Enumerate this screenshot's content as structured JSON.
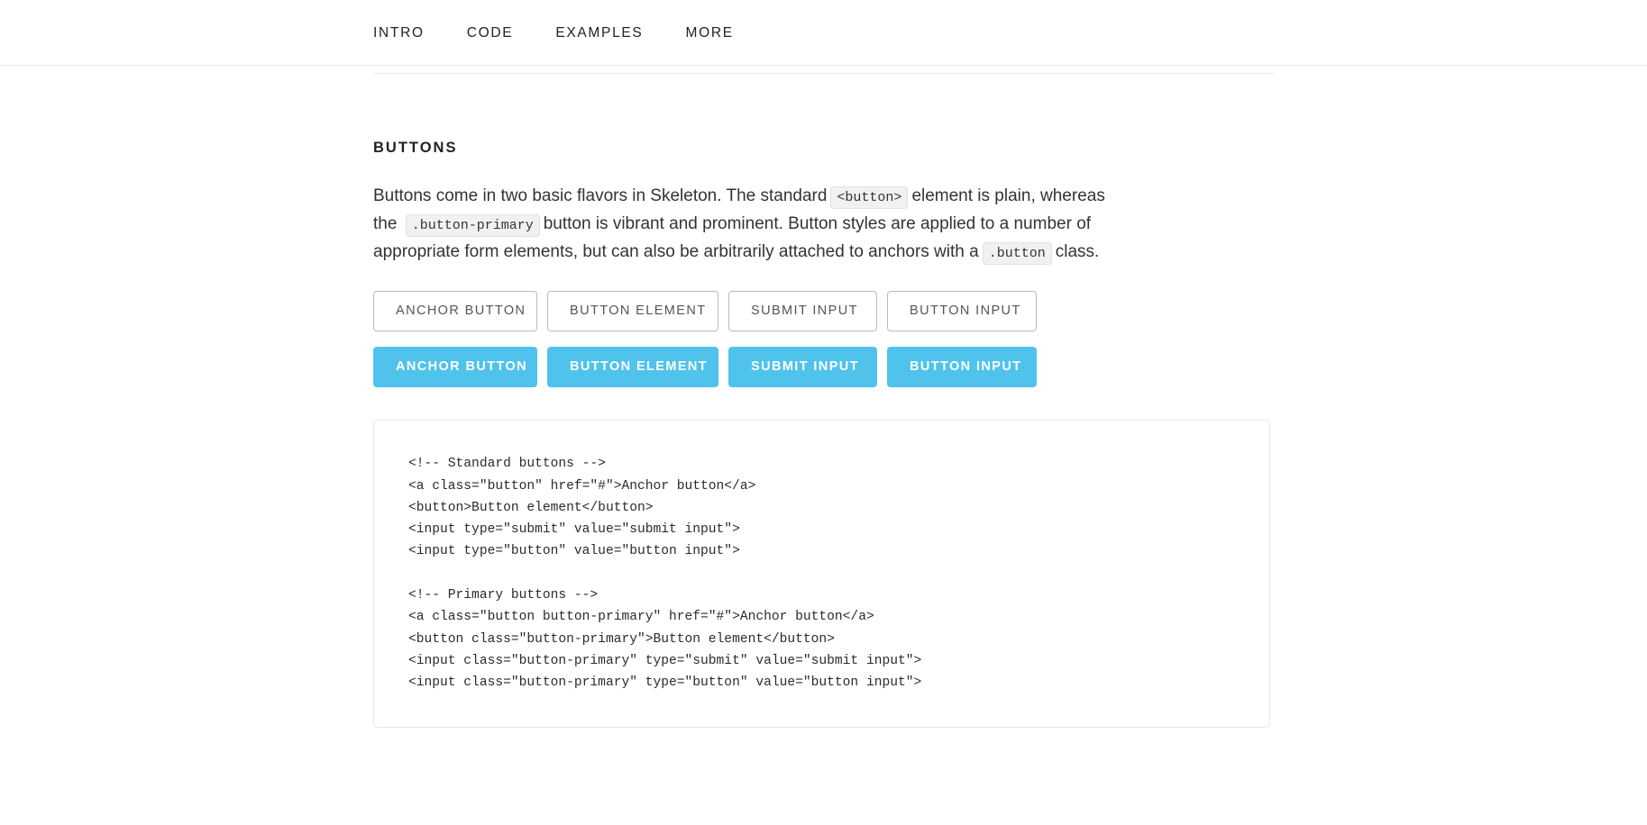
{
  "nav": {
    "items": [
      {
        "label": "INTRO"
      },
      {
        "label": "CODE"
      },
      {
        "label": "EXAMPLES"
      },
      {
        "label": "MORE"
      }
    ]
  },
  "section": {
    "title": "BUTTONS",
    "paragraph": {
      "part1": "Buttons come in two basic flavors in Skeleton. The standard",
      "code1": "<button>",
      "part2": "element is plain, whereas the",
      "code2": ".button-primary",
      "part3": "button is vibrant and prominent. Button styles are applied to a number of appropriate form elements, but can also be arbitrarily attached to anchors with a",
      "code3": ".button",
      "part4": "class."
    }
  },
  "buttons": {
    "standard": [
      {
        "label": "ANCHOR BUTTON"
      },
      {
        "label": "BUTTON ELEMENT"
      },
      {
        "label": "SUBMIT INPUT"
      },
      {
        "label": "BUTTON INPUT"
      }
    ],
    "primary": [
      {
        "label": "ANCHOR BUTTON"
      },
      {
        "label": "BUTTON ELEMENT"
      },
      {
        "label": "SUBMIT INPUT"
      },
      {
        "label": "BUTTON INPUT"
      }
    ]
  },
  "code_sample": "<!-- Standard buttons -->\n<a class=\"button\" href=\"#\">Anchor button</a>\n<button>Button element</button>\n<input type=\"submit\" value=\"submit input\">\n<input type=\"button\" value=\"button input\">\n\n<!-- Primary buttons -->\n<a class=\"button button-primary\" href=\"#\">Anchor button</a>\n<button class=\"button-primary\">Button element</button>\n<input class=\"button-primary\" type=\"submit\" value=\"submit input\">\n<input class=\"button-primary\" type=\"button\" value=\"button input\">",
  "colors": {
    "primary": "#4fc3ec",
    "text": "#222222",
    "border": "#bbbbbb",
    "code_bg": "#f1f1f1"
  }
}
